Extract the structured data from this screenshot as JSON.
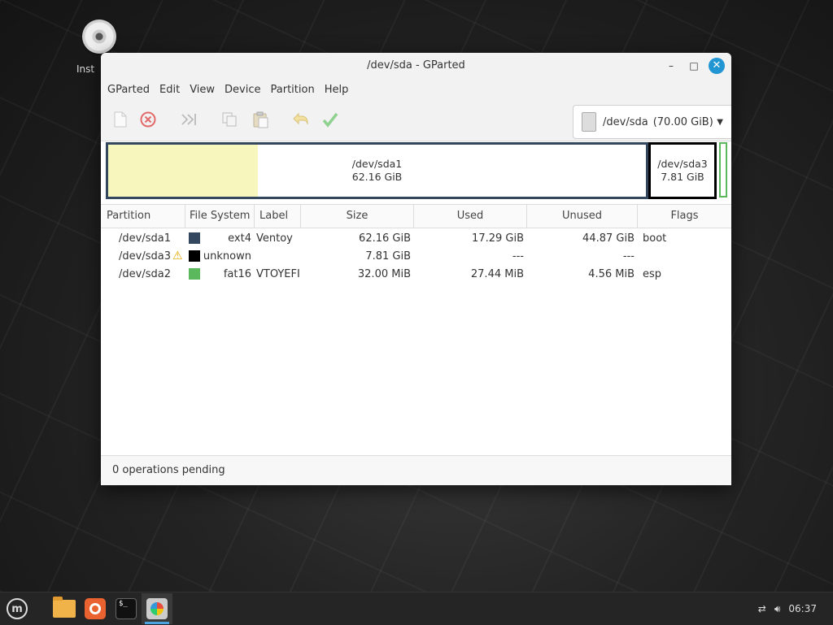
{
  "desktop": {
    "icon_label": "Inst"
  },
  "window": {
    "title": "/dev/sda - GParted",
    "controls": {
      "minimize": "–",
      "maximize": "□",
      "close": "✕"
    }
  },
  "menubar": [
    "GParted",
    "Edit",
    "View",
    "Device",
    "Partition",
    "Help"
  ],
  "toolbar": {
    "device": "/dev/sda",
    "device_size": "(70.00 GiB)"
  },
  "disk_graph": {
    "sda1": {
      "name": "/dev/sda1",
      "size": "62.16 GiB",
      "used_fraction": 0.278
    },
    "sda3": {
      "name": "/dev/sda3",
      "size": "7.81 GiB"
    }
  },
  "table": {
    "headers": [
      "Partition",
      "File System",
      "Label",
      "Size",
      "Used",
      "Unused",
      "Flags"
    ],
    "rows": [
      {
        "partition": "/dev/sda1",
        "warning": false,
        "fs_color": "#33475f",
        "fs": "ext4",
        "label": "Ventoy",
        "size": "62.16 GiB",
        "used": "17.29 GiB",
        "unused": "44.87 GiB",
        "flags": "boot"
      },
      {
        "partition": "/dev/sda3",
        "warning": true,
        "fs_color": "#000000",
        "fs": "unknown",
        "label": "",
        "size": "7.81 GiB",
        "used": "---",
        "unused": "---",
        "flags": ""
      },
      {
        "partition": "/dev/sda2",
        "warning": false,
        "fs_color": "#5cb85c",
        "fs": "fat16",
        "label": "VTOYEFI",
        "size": "32.00 MiB",
        "used": "27.44 MiB",
        "unused": "4.56 MiB",
        "flags": "esp"
      }
    ]
  },
  "status": "0 operations pending",
  "taskbar": {
    "clock": "06:37"
  }
}
